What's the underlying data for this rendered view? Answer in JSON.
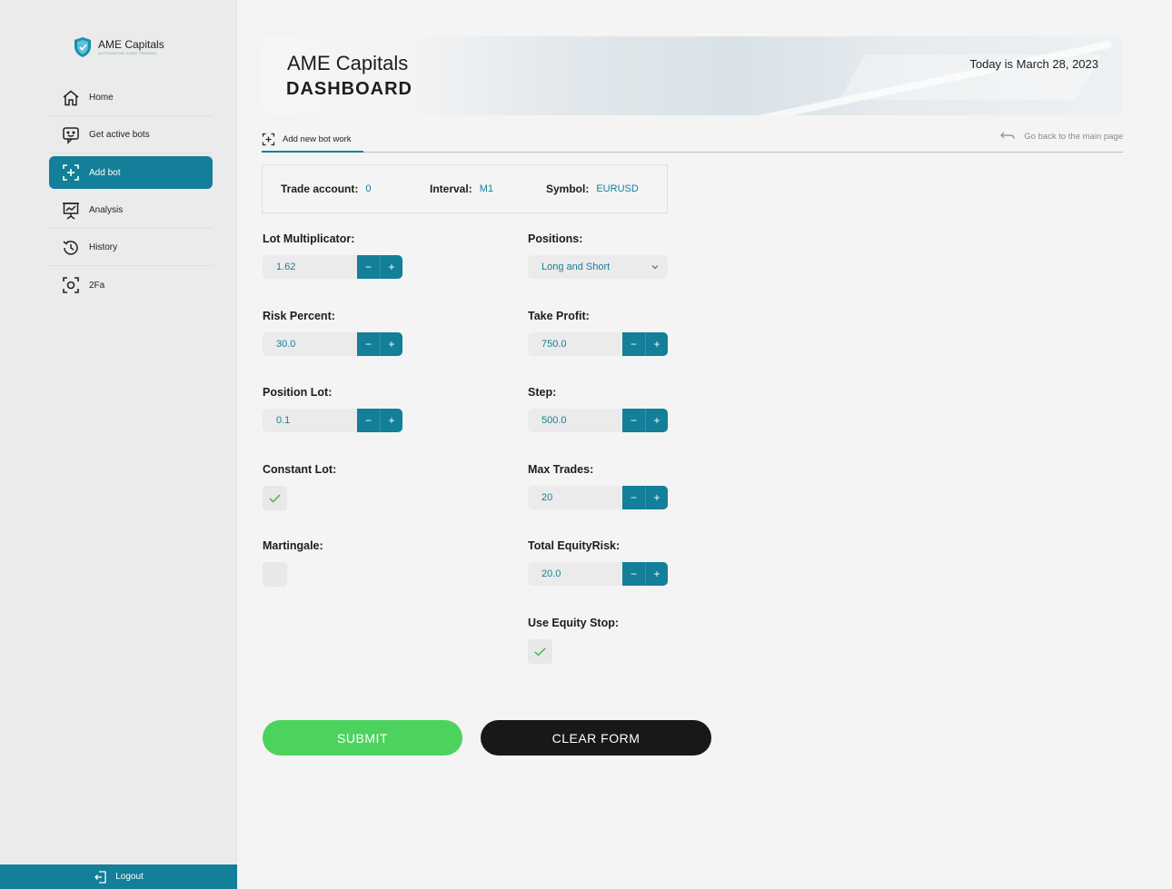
{
  "brand": {
    "name": "AME Capitals",
    "tagline": "AUTOMATING YOUR TRADING",
    "logo_icon": "shield-logo-icon"
  },
  "sidebar": {
    "items": [
      {
        "label": "Home",
        "icon": "home-icon",
        "active": false
      },
      {
        "label": "Get active bots",
        "icon": "chat-bot-icon",
        "active": false
      },
      {
        "label": "Add bot",
        "icon": "add-frame-icon",
        "active": true
      },
      {
        "label": "Analysis",
        "icon": "presentation-chart-icon",
        "active": false
      },
      {
        "label": "History",
        "icon": "history-icon",
        "active": false
      },
      {
        "label": "2Fa",
        "icon": "scan-icon",
        "active": false
      }
    ],
    "logout_label": "Logout"
  },
  "header": {
    "title_line1": "AME Capitals",
    "title_line2": "DASHBOARD",
    "date_text": "Today is March 28, 2023"
  },
  "tabs": {
    "active_tab": "Add new bot work",
    "back_link": "Go back to the main page"
  },
  "info": {
    "trade_account_label": "Trade account:",
    "trade_account_value": "0",
    "interval_label": "Interval:",
    "interval_value": "M1",
    "symbol_label": "Symbol:",
    "symbol_value": "EURUSD"
  },
  "form": {
    "lot_multiplicator": {
      "label": "Lot Multiplicator:",
      "value": "1.62"
    },
    "risk_percent": {
      "label": "Risk Percent:",
      "value": "30.0"
    },
    "position_lot": {
      "label": "Position Lot:",
      "value": "0.1"
    },
    "constant_lot": {
      "label": "Constant Lot:",
      "checked": true
    },
    "martingale": {
      "label": "Martingale:",
      "checked": false
    },
    "positions": {
      "label": "Positions:",
      "value": "Long and Short"
    },
    "take_profit": {
      "label": "Take Profit:",
      "value": "750.0"
    },
    "step": {
      "label": "Step:",
      "value": "500.0"
    },
    "max_trades": {
      "label": "Max Trades:",
      "value": "20"
    },
    "total_equity_risk": {
      "label": "Total EquityRisk:",
      "value": "20.0"
    },
    "use_equity_stop": {
      "label": "Use Equity Stop:",
      "checked": true
    },
    "minus_symbol": "−",
    "plus_symbol": "+"
  },
  "actions": {
    "submit_label": "SUBMIT",
    "clear_label": "CLEAR FORM"
  },
  "colors": {
    "accent": "#137f99",
    "submit": "#4cd35e",
    "clear": "#181818",
    "check": "#3cb84c"
  }
}
